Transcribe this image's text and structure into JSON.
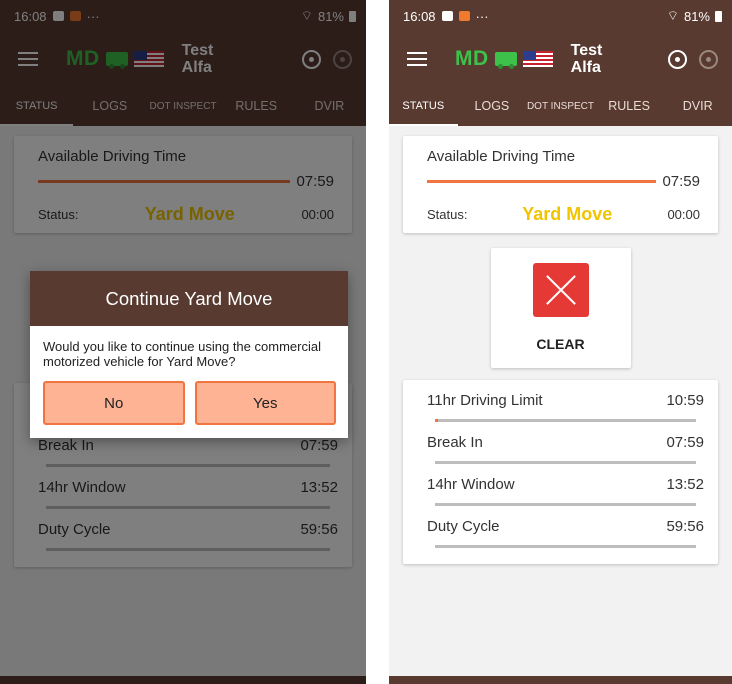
{
  "status_bar": {
    "time": "16:08",
    "more": "···",
    "battery": "81%"
  },
  "app_bar": {
    "logo_text": "MD",
    "driver_name": "Test Alfa"
  },
  "tabs": [
    {
      "label": "STATUS",
      "active": true
    },
    {
      "label": "LOGS",
      "active": false
    },
    {
      "label": "DOT INSPECT",
      "active": false
    },
    {
      "label": "RULES",
      "active": false
    },
    {
      "label": "DVIR",
      "active": false
    }
  ],
  "available_driving": {
    "title": "Available Driving Time",
    "time": "07:59",
    "progress": 1.0
  },
  "status": {
    "label": "Status:",
    "value": "Yard Move",
    "time": "00:00"
  },
  "clear_button": {
    "label": "CLEAR"
  },
  "limits": [
    {
      "label": "11hr Driving Limit",
      "time": "10:59",
      "progress": 0.01
    },
    {
      "label": "Break In",
      "time": "07:59",
      "progress": 0
    },
    {
      "label": "14hr Window",
      "time": "13:52",
      "progress": 0
    },
    {
      "label": "Duty Cycle",
      "time": "59:56",
      "progress": 0
    }
  ],
  "dialog": {
    "title": "Continue Yard Move",
    "message": "Would you like to continue using the commercial motorized vehicle for Yard Move?",
    "no_label": "No",
    "yes_label": "Yes"
  },
  "colors": {
    "brand_brown": "#583a30",
    "accent_orange": "#f07540",
    "status_yellow": "#f0c400",
    "clear_red": "#e53935",
    "logo_green": "#3ec14a"
  }
}
